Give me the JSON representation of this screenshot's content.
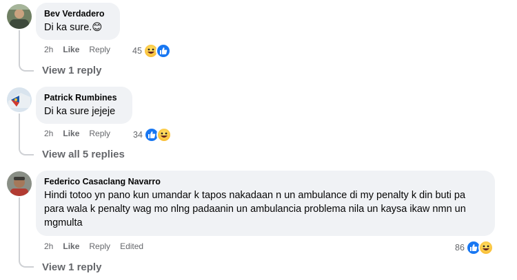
{
  "comments": [
    {
      "author": "Bev Verdadero",
      "text": "Di ka sure.😊",
      "time": "2h",
      "like_label": "Like",
      "reply_label": "Reply",
      "edited": "",
      "reaction_count": "45",
      "reactions": [
        "haha-icon",
        "like-icon"
      ],
      "view_replies": "View 1 reply"
    },
    {
      "author": "Patrick Rumbines",
      "text": "Di ka sure jejeje",
      "time": "2h",
      "like_label": "Like",
      "reply_label": "Reply",
      "edited": "",
      "reaction_count": "34",
      "reactions": [
        "like-icon",
        "haha-icon"
      ],
      "view_replies": "View all 5 replies"
    },
    {
      "author": "Federico Casaclang Navarro",
      "text": "Hindi totoo yn pano kun umandar k tapos nakadaan n un ambulance di my penalty k din buti pa para wala k penalty wag mo nlng padaanin un ambulancia problema nila un kaysa ikaw nmn un mgmulta",
      "time": "2h",
      "like_label": "Like",
      "reply_label": "Reply",
      "edited": "Edited",
      "reaction_count": "86",
      "reactions": [
        "like-icon",
        "haha-icon"
      ],
      "view_replies": "View 1 reply"
    }
  ],
  "colors": {
    "bubble_bg": "#f0f2f5",
    "meta_text": "#65676b",
    "like_blue": "#1877f2",
    "haha_yellow": "#f7b125",
    "thread_line": "#ced0d4"
  }
}
